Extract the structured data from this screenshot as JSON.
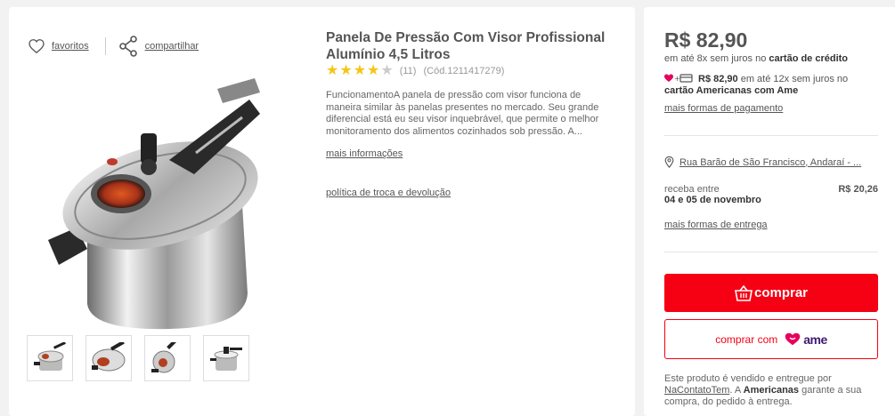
{
  "actions": {
    "favorites_label": "favoritos",
    "share_label": "compartilhar"
  },
  "product": {
    "title": "Panela De Pressão Com Visor Profissional Alumínio 4,5 Litros",
    "rating": 4,
    "reviews_count": "(11)",
    "code": "(Cód.1211417279)",
    "description": "FuncionamentoA panela de pressão com visor funciona de maneira similar às panelas presentes no mercado. Seu grande diferencial está eu seu visor inquebrável, que permite o melhor monitoramento dos alimentos cozinhados sob pressão. A...",
    "more_info_label": "mais informações",
    "policy_label": "política de troca e devolução",
    "thumbnails": [
      "thumb-1",
      "thumb-2",
      "thumb-3",
      "thumb-4"
    ]
  },
  "pricing": {
    "price": "R$ 82,90",
    "installments_prefix": "em até 8x sem juros no ",
    "installments_card": "cartão de crédito",
    "ame_price": "R$ 82,90",
    "ame_text": " em até 12x sem juros no ",
    "ame_card": "cartão Americanas com Ame",
    "more_payment_label": "mais formas de pagamento"
  },
  "shipping": {
    "address": "Rua Barão de São Francisco, Andaraí - ...",
    "receive_label": "receba entre",
    "dates": "04 e 05 de novembro",
    "fee": "R$ 20,26",
    "more_shipping_label": "mais formas de entrega"
  },
  "buttons": {
    "buy_label": "comprar",
    "buy_with_label": "comprar com",
    "ame_logo_text": "ame"
  },
  "seller": {
    "prefix": "Este produto é vendido e entregue por ",
    "name": "NaContatoTem",
    "middle": ". A ",
    "brand": "Americanas",
    "suffix": " garante a sua compra, do pedido à entrega."
  },
  "colors": {
    "accent_red": "#f60014",
    "star": "#f5c518",
    "ame_pink": "#e6005c",
    "ame_purple": "#3d1c6e"
  }
}
